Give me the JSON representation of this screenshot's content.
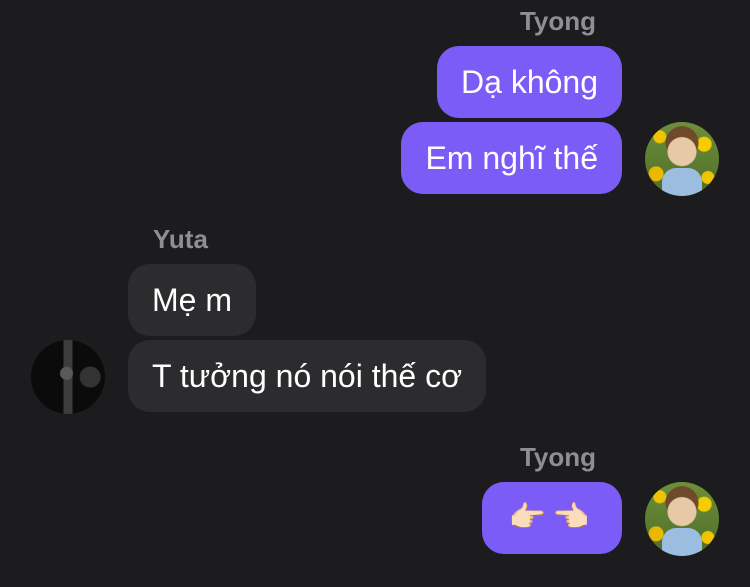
{
  "messages": [
    {
      "sender": "Tyong",
      "text": "Dạ không"
    },
    {
      "sender": "Tyong",
      "text": "Em nghĩ thế"
    },
    {
      "sender": "Yuta",
      "text": "Mẹ m"
    },
    {
      "sender": "Yuta",
      "text": "T tưởng nó nói thế cơ"
    },
    {
      "sender": "Tyong",
      "text": "👉🏻👈🏻"
    }
  ],
  "senders": {
    "tyong": "Tyong",
    "yuta": "Yuta"
  },
  "colors": {
    "outgoing_bubble": "#7b5cf7",
    "incoming_bubble": "#2c2c2e",
    "background": "#1c1c1e",
    "name": "#8e8e93"
  }
}
